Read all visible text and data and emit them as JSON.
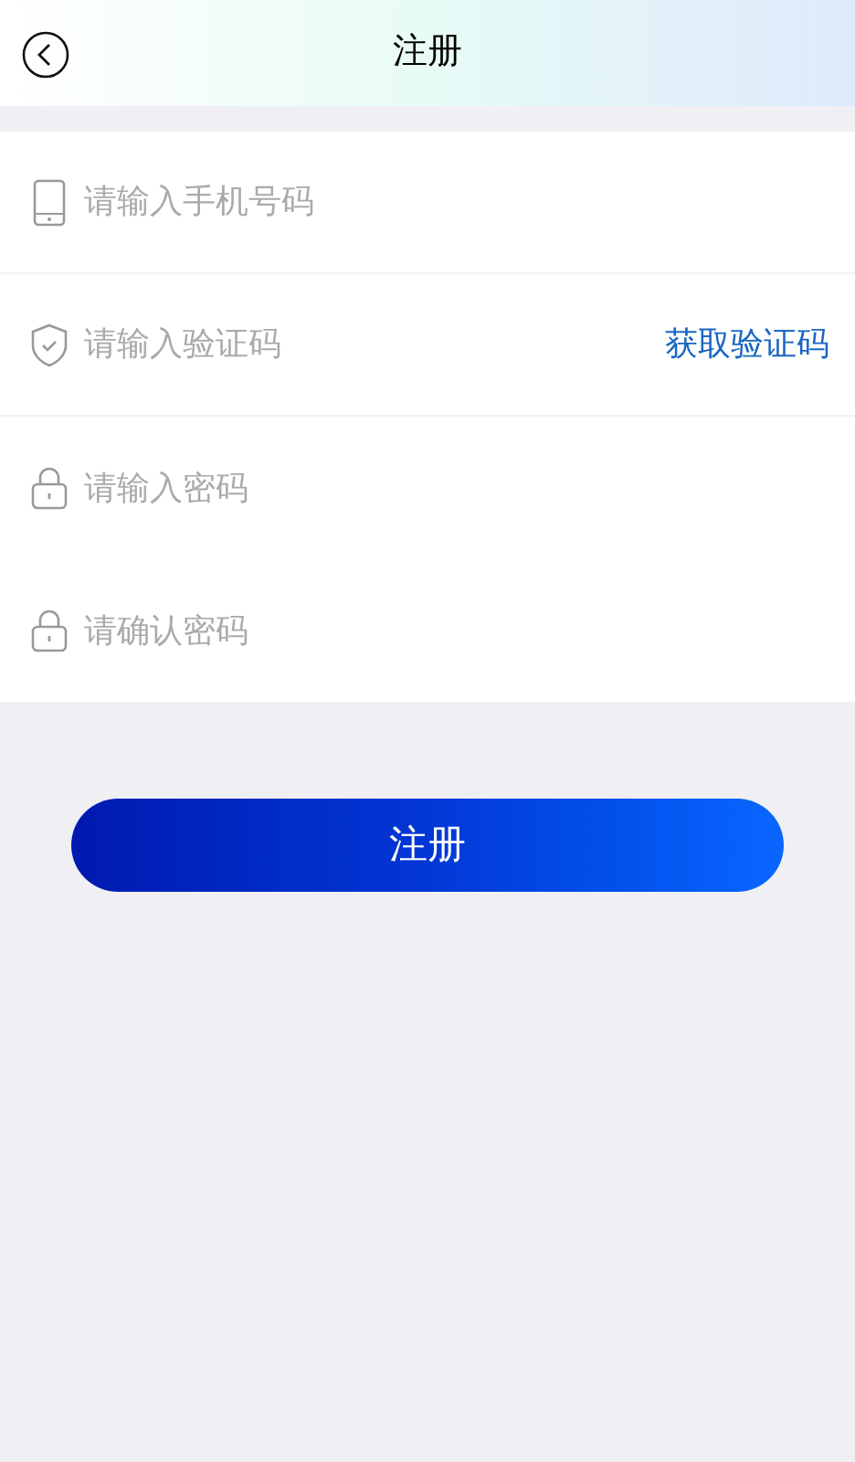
{
  "header": {
    "title": "注册"
  },
  "fields": [
    {
      "kind": "phone",
      "placeholder": "请输入手机号码"
    },
    {
      "kind": "code",
      "placeholder": "请输入验证码",
      "action": "获取验证码"
    },
    {
      "kind": "password",
      "placeholder": "请输入密码"
    },
    {
      "kind": "password",
      "placeholder": "请确认密码"
    }
  ],
  "submit": "注册"
}
